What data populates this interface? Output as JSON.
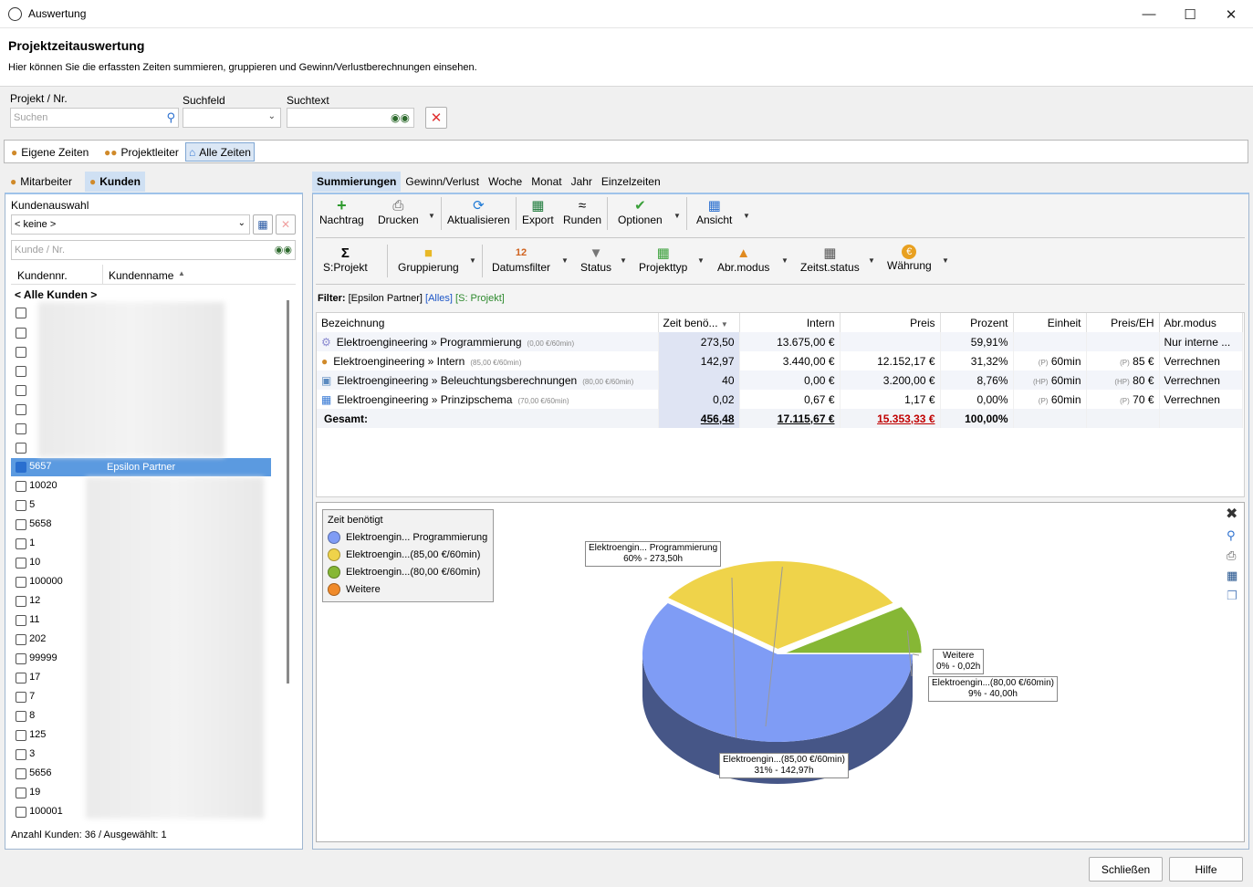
{
  "window": {
    "title": "Auswertung"
  },
  "header": {
    "title": "Projektzeitauswertung",
    "description": "Hier können Sie die erfassten Zeiten summieren, gruppieren und Gewinn/Verlustberechnungen einsehen."
  },
  "search": {
    "project_label": "Projekt / Nr.",
    "project_placeholder": "Suchen",
    "field_label": "Suchfeld",
    "text_label": "Suchtext"
  },
  "view_tabs": [
    "Eigene Zeiten",
    "Projektleiter",
    "Alle Zeiten"
  ],
  "left": {
    "tabs": [
      "Mitarbeiter",
      "Kunden"
    ],
    "customer_select_label": "Kundenauswahl",
    "customer_select_value": "< keine >",
    "filter_placeholder": "Kunde / Nr.",
    "col_nr": "Kundennr.",
    "col_name": "Kundenname",
    "all_customers": "< Alle Kunden >",
    "status": "Anzahl Kunden: 36 / Ausgewählt: 1",
    "rows": [
      {
        "nr": "",
        "name": ""
      },
      {
        "nr": "",
        "name": ""
      },
      {
        "nr": "",
        "name": ""
      },
      {
        "nr": "",
        "name": ""
      },
      {
        "nr": "",
        "name": ""
      },
      {
        "nr": "",
        "name": ""
      },
      {
        "nr": "",
        "name": ""
      },
      {
        "nr": "",
        "name": ""
      },
      {
        "nr": "5657",
        "name": "Epsilon Partner",
        "checked": true
      },
      {
        "nr": "10020",
        "name": ""
      },
      {
        "nr": "5",
        "name": ""
      },
      {
        "nr": "5658",
        "name": ""
      },
      {
        "nr": "1",
        "name": ""
      },
      {
        "nr": "10",
        "name": ""
      },
      {
        "nr": "100000",
        "name": ""
      },
      {
        "nr": "12",
        "name": ""
      },
      {
        "nr": "11",
        "name": ""
      },
      {
        "nr": "202",
        "name": ""
      },
      {
        "nr": "99999",
        "name": ""
      },
      {
        "nr": "17",
        "name": ""
      },
      {
        "nr": "7",
        "name": ""
      },
      {
        "nr": "8",
        "name": ""
      },
      {
        "nr": "125",
        "name": ""
      },
      {
        "nr": "3",
        "name": ""
      },
      {
        "nr": "5656",
        "name": ""
      },
      {
        "nr": "19",
        "name": ""
      },
      {
        "nr": "100001",
        "name": ""
      }
    ]
  },
  "right": {
    "tabs": [
      "Summierungen",
      "Gewinn/Verlust",
      "Woche",
      "Monat",
      "Jahr",
      "Einzelzeiten"
    ],
    "toolbar1": [
      "Nachtrag",
      "Drucken",
      "Aktualisieren",
      "Export",
      "Runden",
      "Optionen",
      "Ansicht"
    ],
    "toolbar2": [
      "S:Projekt",
      "Gruppierung",
      "Datumsfilter",
      "Status",
      "Projekttyp",
      "Abr.modus",
      "Zeitst.status",
      "Währung"
    ],
    "filter": {
      "label": "Filter:",
      "customer": "[Epsilon Partner]",
      "all": "[Alles]",
      "group": "[S: Projekt]"
    },
    "columns": [
      "Bezeichnung",
      "Zeit benö...",
      "Intern",
      "Preis",
      "Prozent",
      "Einheit",
      "Preis/EH",
      "Abr.modus"
    ],
    "rows": [
      {
        "name": "Elektroengineering » Programmierung",
        "rate": "(0,00 €/60min)",
        "zeit": "273,50",
        "intern": "13.675,00 €",
        "preis": "",
        "prozent": "59,91%",
        "einheit_tag": "",
        "einheit": "",
        "preiseh_tag": "",
        "preiseh": "",
        "modus": "Nur interne ..."
      },
      {
        "name": "Elektroengineering » Intern",
        "rate": "(85,00 €/60min)",
        "zeit": "142,97",
        "intern": "3.440,00 €",
        "preis": "12.152,17 €",
        "prozent": "31,32%",
        "einheit_tag": "(P)",
        "einheit": "60min",
        "preiseh_tag": "(P)",
        "preiseh": "85 €",
        "modus": "Verrechnen"
      },
      {
        "name": "Elektroengineering » Beleuchtungsberechnungen",
        "rate": "(80,00 €/60min)",
        "zeit": "40",
        "intern": "0,00 €",
        "preis": "3.200,00 €",
        "prozent": "8,76%",
        "einheit_tag": "(HP)",
        "einheit": "60min",
        "preiseh_tag": "(HP)",
        "preiseh": "80 €",
        "modus": "Verrechnen"
      },
      {
        "name": "Elektroengineering » Prinzipschema",
        "rate": "(70,00 €/60min)",
        "zeit": "0,02",
        "intern": "0,67 €",
        "preis": "1,17 €",
        "prozent": "0,00%",
        "einheit_tag": "(P)",
        "einheit": "60min",
        "preiseh_tag": "(P)",
        "preiseh": "70 €",
        "modus": "Verrechnen"
      }
    ],
    "total": {
      "label": "Gesamt:",
      "zeit": "456,48",
      "intern": "17.115,67 €",
      "preis": "15.353,33 €",
      "prozent": "100,00%"
    }
  },
  "chart_data": {
    "type": "pie",
    "title": "Zeit benötigt",
    "slices": [
      {
        "label": "Elektroengin... Programmierung",
        "value": 273.5,
        "callout": "60% - 273,50h",
        "color": "#7f9cf5"
      },
      {
        "label": "Elektroengin...(85,00 €/60min)",
        "value": 142.97,
        "callout": "31% - 142,97h",
        "color": "#efd34a"
      },
      {
        "label": "Elektroengin...(80,00 €/60min)",
        "value": 40,
        "callout": "9% - 40,00h",
        "color": "#86b735"
      },
      {
        "label": "Weitere",
        "value": 0.02,
        "callout": "0% - 0,02h",
        "color": "#f08a2a"
      }
    ]
  },
  "footer": {
    "close": "Schließen",
    "help": "Hilfe"
  }
}
